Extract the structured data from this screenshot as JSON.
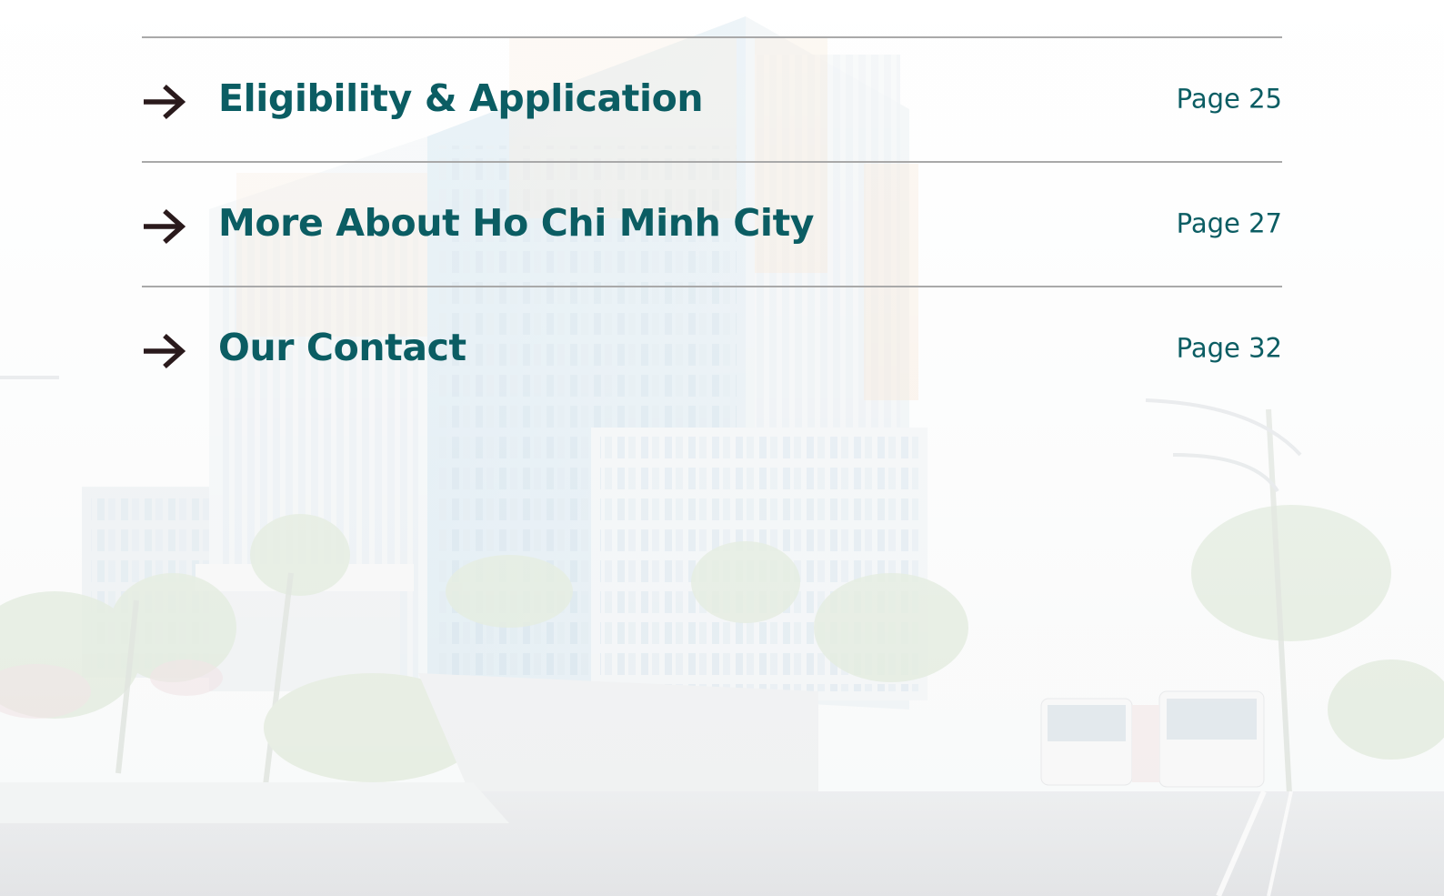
{
  "colors": {
    "heading": "#0b5d63",
    "arrow": "#2a1a1c",
    "rule": "#a9a9a9"
  },
  "toc": {
    "entries": [
      {
        "title": "Eligibility & Application",
        "page": "Page 25",
        "icon": "arrow-right-icon"
      },
      {
        "title": "More About Ho Chi Minh City",
        "page": "Page 27",
        "icon": "arrow-right-icon"
      },
      {
        "title": "Our Contact",
        "page": "Page 32",
        "icon": "arrow-right-icon"
      }
    ]
  }
}
